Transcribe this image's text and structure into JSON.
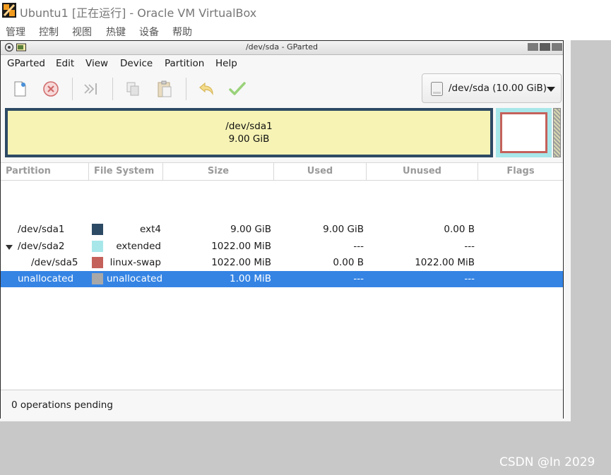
{
  "host": {
    "title": "Ubuntu1 [正在运行] - Oracle VM VirtualBox",
    "menu": [
      "管理",
      "控制",
      "视图",
      "热键",
      "设备",
      "帮助"
    ]
  },
  "gparted": {
    "window_title": "/dev/sda - GParted",
    "menu": [
      "GParted",
      "Edit",
      "View",
      "Device",
      "Partition",
      "Help"
    ],
    "toolbar": {
      "new_icon": "new-partition-icon",
      "delete_icon": "delete-icon",
      "resize_icon": "resize-move-icon",
      "copy_icon": "copy-icon",
      "paste_icon": "paste-icon",
      "undo_icon": "undo-icon",
      "apply_icon": "apply-checkmark-icon"
    },
    "device_selector": {
      "label": "/dev/sda (10.00 GiB)",
      "icon": "disk-drive-icon"
    },
    "visual": {
      "main_name": "/dev/sda1",
      "main_size": "9.00 GiB",
      "colors": {
        "ext4": "#2d4a64",
        "extended": "#a7e7ea",
        "linux_swap": "#c4615a",
        "unallocated": "#a8a8a8",
        "ext4_fill": "#f6f3b4"
      }
    },
    "columns": [
      "Partition",
      "File System",
      "Size",
      "Used",
      "Unused",
      "Flags"
    ],
    "rows": [
      {
        "partition": "/dev/sda1",
        "fs": "ext4",
        "fs_color": "#2d4a64",
        "size": "9.00 GiB",
        "used": "9.00 GiB",
        "unused": "0.00 B",
        "flags": ""
      },
      {
        "partition": "/dev/sda2",
        "fs": "extended",
        "fs_color": "#a7e7ea",
        "size": "1022.00 MiB",
        "used": "---",
        "unused": "---",
        "flags": ""
      },
      {
        "partition": "/dev/sda5",
        "fs": "linux-swap",
        "fs_color": "#c4615a",
        "size": "1022.00 MiB",
        "used": "0.00 B",
        "unused": "1022.00 MiB",
        "flags": ""
      },
      {
        "partition": "unallocated",
        "fs": "unallocated",
        "fs_color": "#a8a8a8",
        "size": "1.00 MiB",
        "used": "---",
        "unused": "---",
        "flags": ""
      }
    ],
    "selected_row": 3,
    "status": "0 operations pending"
  },
  "watermark": "CSDN @In 2029"
}
